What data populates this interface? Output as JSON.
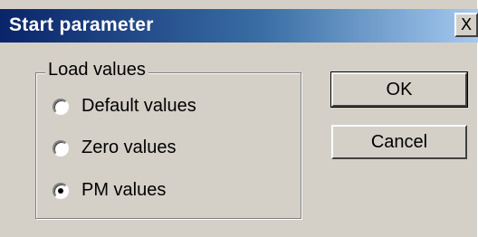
{
  "window": {
    "title": "Start parameter",
    "close_glyph": "X"
  },
  "load_values": {
    "legend": "Load values",
    "options": [
      {
        "label": "Default values",
        "selected": false
      },
      {
        "label": "Zero values",
        "selected": false
      },
      {
        "label": "PM values",
        "selected": true
      }
    ]
  },
  "buttons": {
    "ok_label": "OK",
    "cancel_label": "Cancel"
  }
}
